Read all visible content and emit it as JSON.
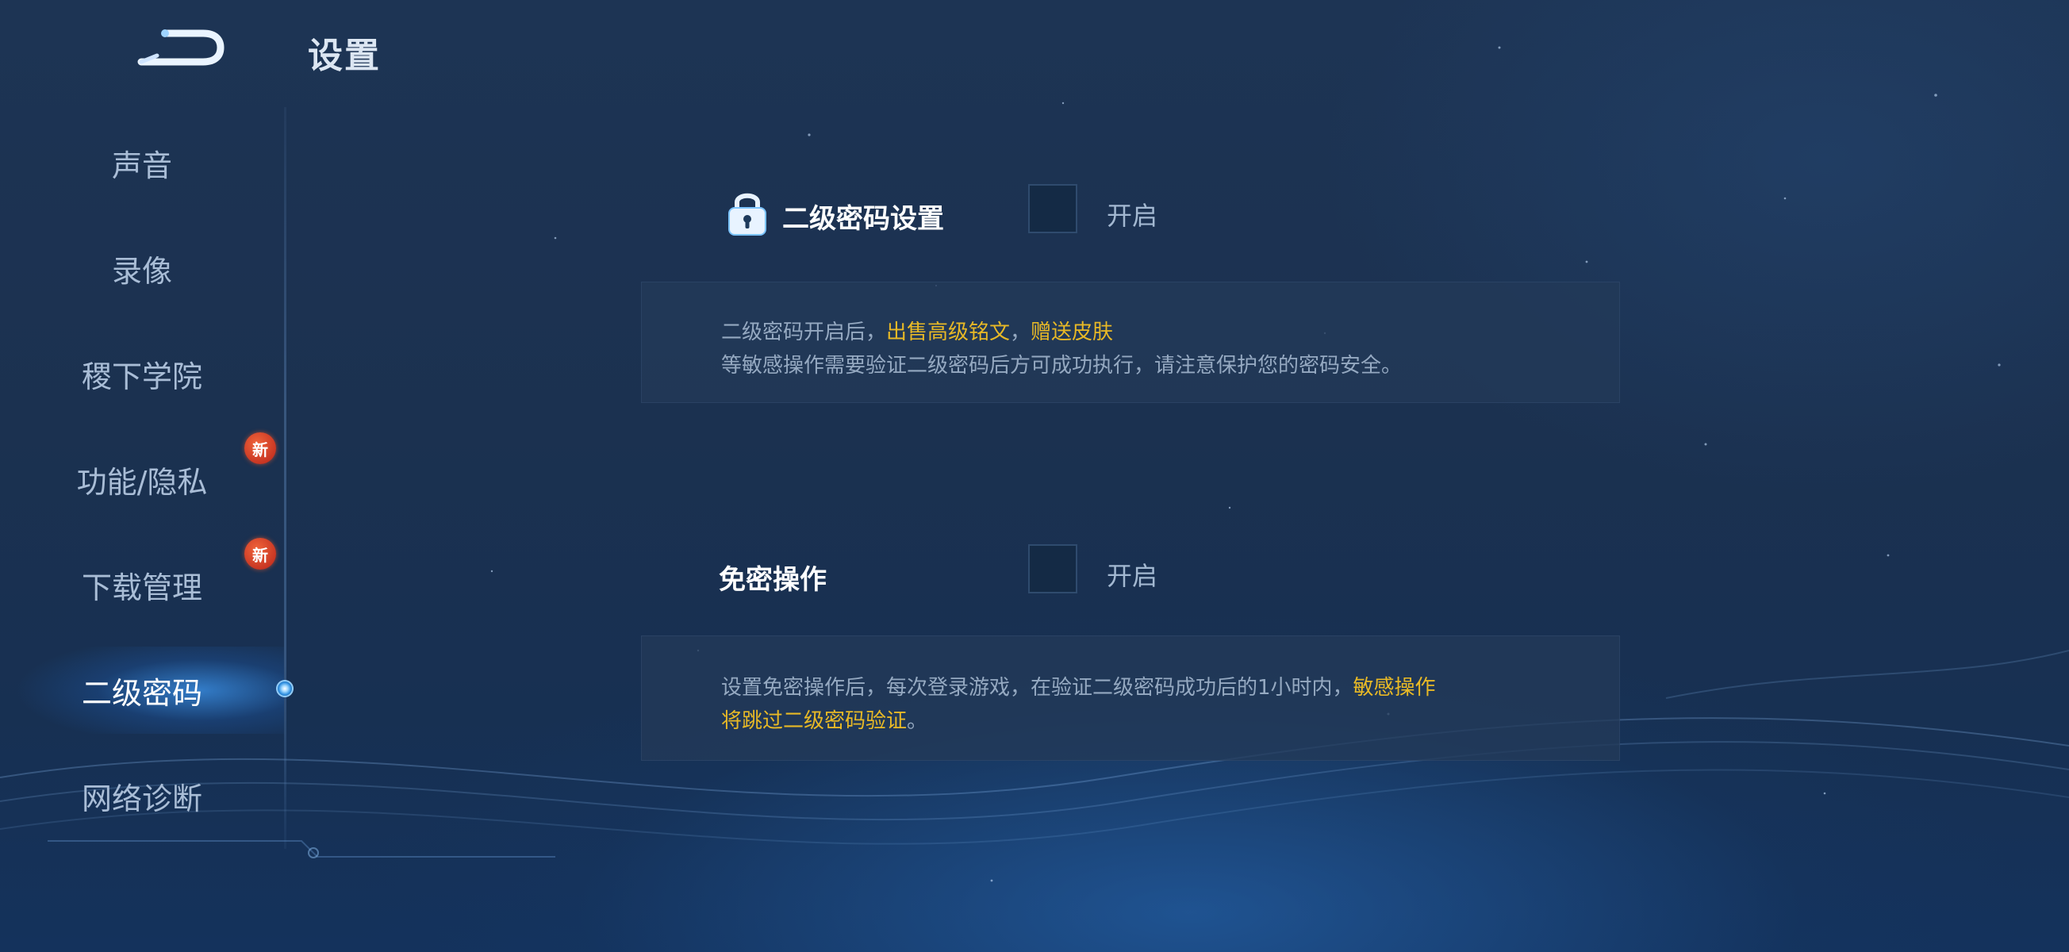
{
  "header": {
    "title": "设置"
  },
  "sidebar": {
    "items": [
      {
        "label": "声音",
        "badge": ""
      },
      {
        "label": "录像",
        "badge": ""
      },
      {
        "label": "稷下学院",
        "badge": ""
      },
      {
        "label": "功能/隐私",
        "badge": "新"
      },
      {
        "label": "下载管理",
        "badge": "新"
      },
      {
        "label": "二级密码",
        "badge": "",
        "active": true
      },
      {
        "label": "网络诊断",
        "badge": ""
      }
    ]
  },
  "second_password": {
    "label": "二级密码设置",
    "toggle_label": "开启",
    "checked": false,
    "info": {
      "line1_prefix": "二级密码开启后，",
      "line1_hl1": "出售高级铭文",
      "line1_sep": "，",
      "line1_hl2": "赠送皮肤",
      "line2": "等敏感操作需要验证二级密码后方可成功执行，请注意保护您的密码安全。"
    }
  },
  "password_free": {
    "label": "免密操作",
    "toggle_label": "开启",
    "checked": false,
    "info": {
      "line1_prefix": "设置免密操作后，每次登录游戏，在验证二级密码成功后的1小时内，",
      "line1_hl": "敏感操作",
      "line2_hl": "将跳过二级密码验证",
      "line2_suffix": "。"
    }
  },
  "colors": {
    "highlight": "#e8b926",
    "active_glow": "#3c96f0",
    "badge": "#d8392a"
  },
  "icons": {
    "back": "back-arrow-icon",
    "lock": "lock-icon"
  }
}
